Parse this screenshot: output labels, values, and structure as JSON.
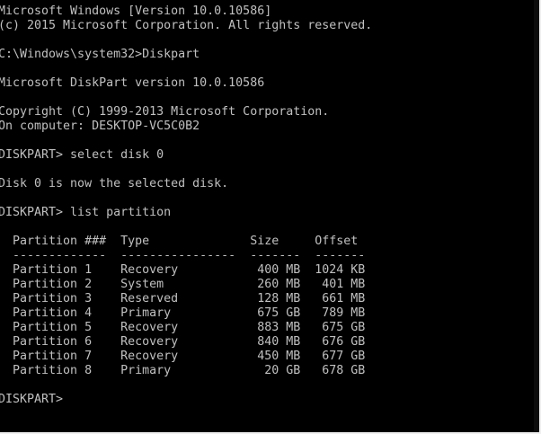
{
  "console": {
    "banner_version": "Microsoft Windows [Version 10.0.10586]",
    "banner_copyright": "(c) 2015 Microsoft Corporation. All rights reserved.",
    "prompt_diskpart": "C:\\Windows\\system32>Diskpart",
    "diskpart_version": "Microsoft DiskPart version 10.0.10586",
    "diskpart_copyright": "Copyright (C) 1999-2013 Microsoft Corporation.",
    "computer_name": "On computer: DESKTOP-VC5C0B2",
    "cmd_select_disk": "DISKPART> select disk 0",
    "select_result": "Disk 0 is now the selected disk.",
    "cmd_list_partition": "DISKPART> list partition",
    "table_header": "  Partition ###  Type              Size     Offset",
    "table_separator": "  -------------  ----------------  -------  -------",
    "partitions": [
      "  Partition 1    Recovery           400 MB  1024 KB",
      "  Partition 2    System             260 MB   401 MB",
      "  Partition 3    Reserved           128 MB   661 MB",
      "  Partition 4    Primary            675 GB   789 MB",
      "  Partition 5    Recovery           883 MB   675 GB",
      "  Partition 6    Recovery           840 MB   676 GB",
      "  Partition 7    Recovery           450 MB   677 GB",
      "  Partition 8    Primary             20 GB   678 GB"
    ],
    "final_prompt": "DISKPART> "
  }
}
